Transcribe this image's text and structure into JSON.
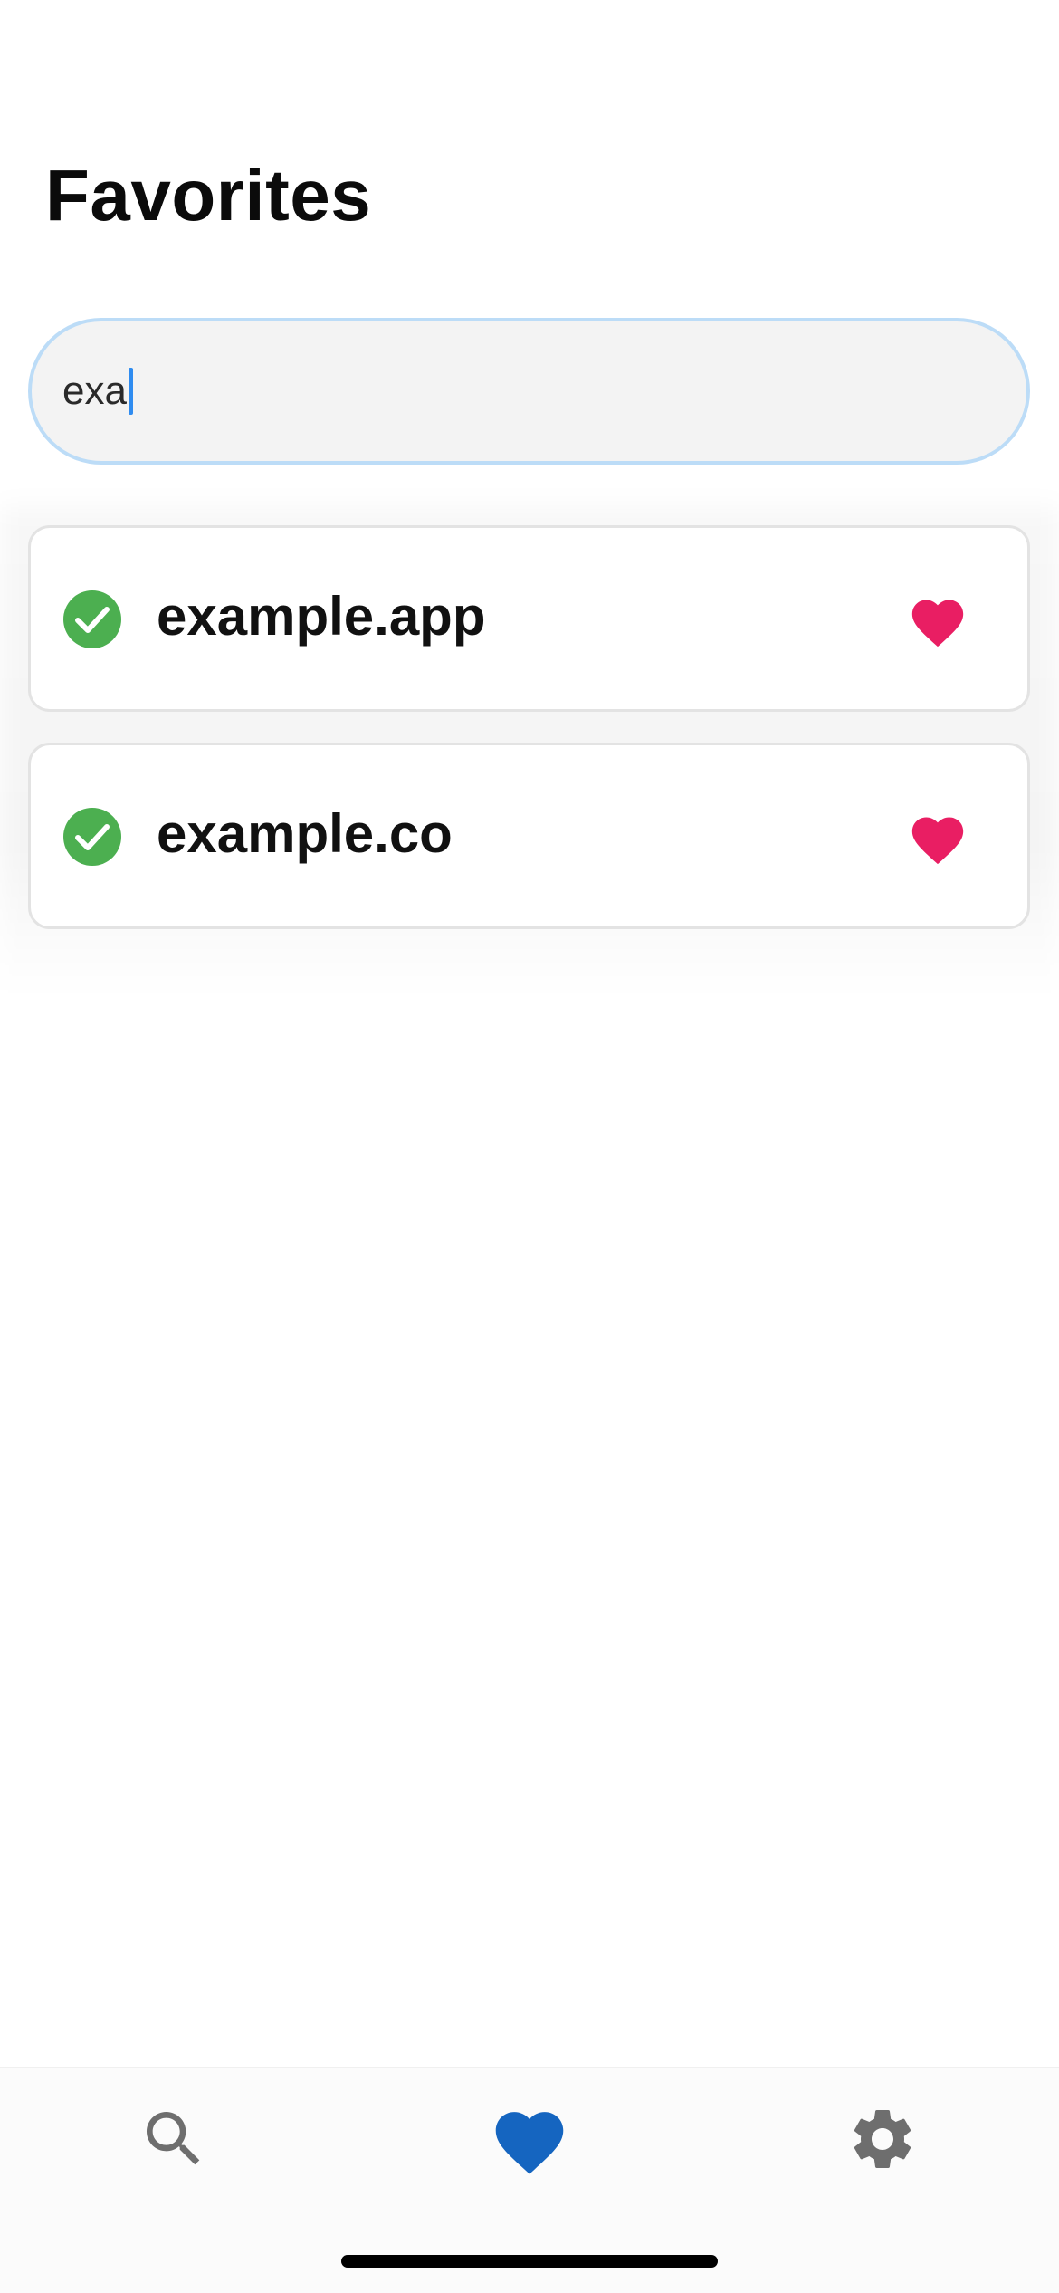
{
  "page": {
    "title": "Favorites"
  },
  "search": {
    "value": "exa"
  },
  "results": [
    {
      "domain": "example.app",
      "status_icon": "check-circle-icon",
      "favorite": true
    },
    {
      "domain": "example.co",
      "status_icon": "check-circle-icon",
      "favorite": true
    }
  ],
  "bottom_nav": {
    "items": [
      {
        "icon": "search-icon",
        "active": false
      },
      {
        "icon": "heart-icon",
        "active": true
      },
      {
        "icon": "gear-icon",
        "active": false
      }
    ]
  },
  "colors": {
    "accent": "#1565C0",
    "favorite": "#E91E63",
    "success": "#4CAF50",
    "inactive_icon": "#6E6E6E",
    "search_border": "#BCDCF7",
    "caret": "#2F8CF0"
  }
}
